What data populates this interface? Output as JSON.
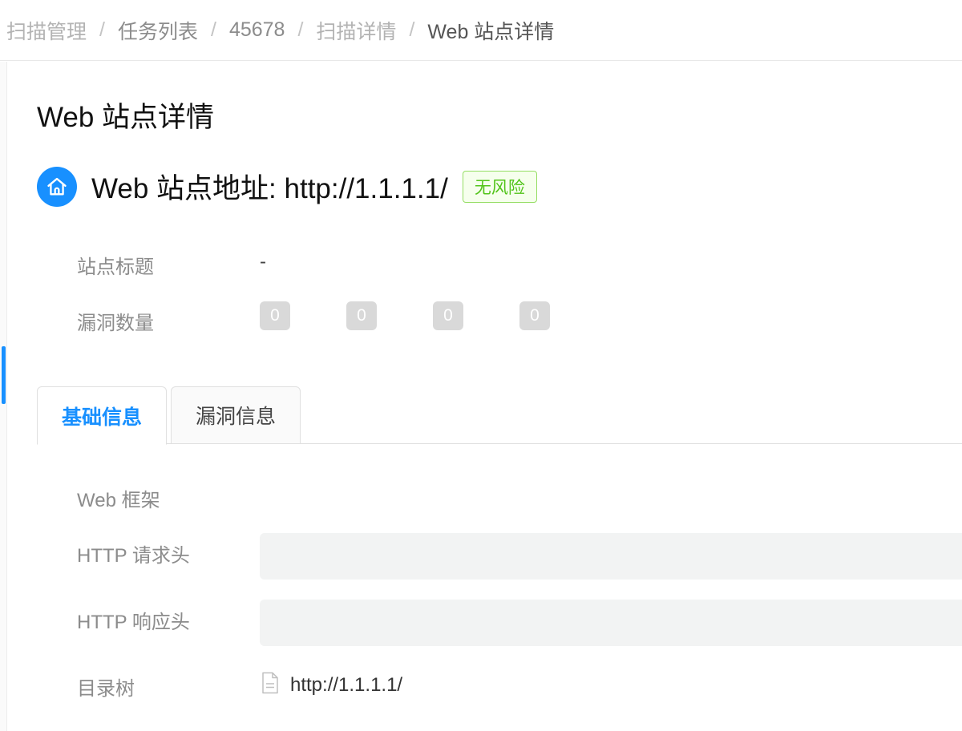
{
  "breadcrumb": {
    "items": [
      {
        "label": "扫描管理"
      },
      {
        "label": "任务列表"
      },
      {
        "label": "45678"
      },
      {
        "label": "扫描详情"
      },
      {
        "label": "Web 站点详情"
      }
    ],
    "separator": "/"
  },
  "page": {
    "title": "Web 站点详情"
  },
  "site": {
    "address_label": "Web 站点地址: http://1.1.1.1/",
    "risk_badge": "无风险",
    "icon": "home-icon"
  },
  "overview": {
    "title_label": "站点标题",
    "title_value": "-",
    "vuln_label": "漏洞数量",
    "vuln_counts": [
      "0",
      "0",
      "0",
      "0"
    ]
  },
  "tabs": [
    {
      "label": "基础信息",
      "active": true
    },
    {
      "label": "漏洞信息",
      "active": false
    }
  ],
  "basic_info": {
    "framework_label": "Web 框架",
    "request_header_label": "HTTP 请求头",
    "request_header_value": "",
    "response_header_label": "HTTP 响应头",
    "response_header_value": "",
    "dir_tree_label": "目录树",
    "dir_tree_item": "http://1.1.1.1/",
    "dir_tree_icon": "file-icon"
  },
  "colors": {
    "accent": "#1890ff",
    "risk_badge_text": "#52c41a",
    "risk_badge_border": "#95de64",
    "count_badge_bg": "#d9d9d9"
  }
}
